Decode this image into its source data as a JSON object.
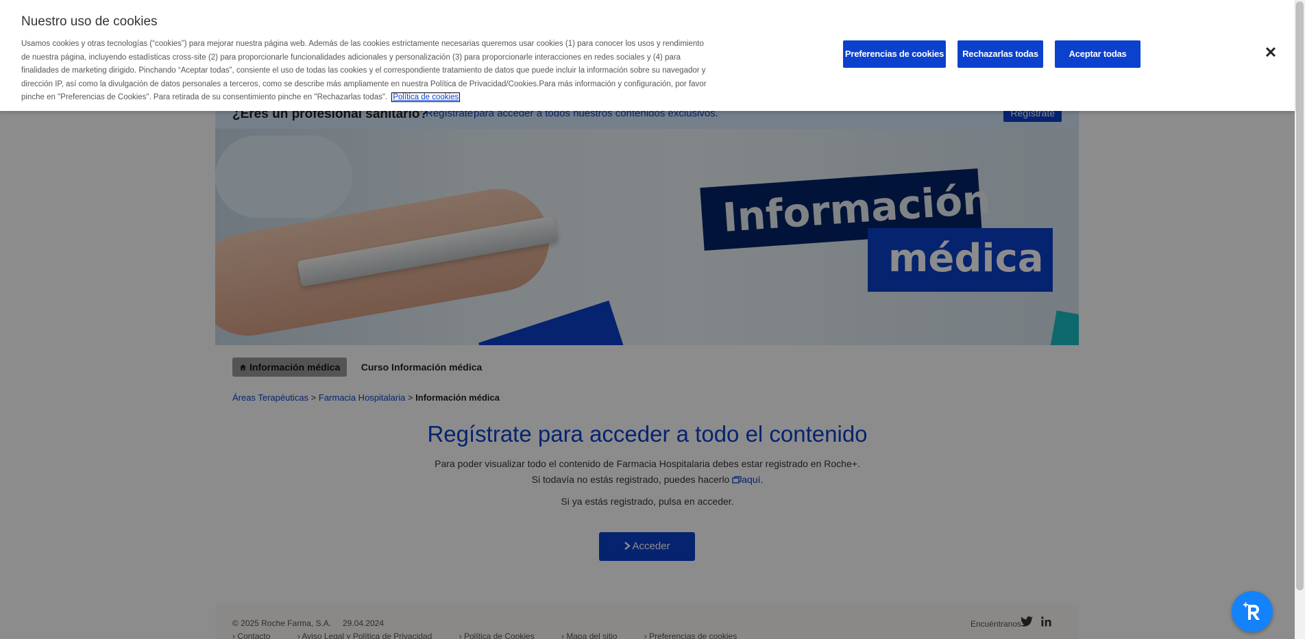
{
  "cookie_banner": {
    "title": "Nuestro uso de cookies",
    "body": "Usamos cookies y otras tecnologías (“cookies”) para mejorar nuestra página web. Además de las cookies estrictamente necesarias queremos usar cookies (1) para conocer los usos y rendimiento de nuestra página, incluyendo estadísticas cross-site (2) para proporcionarle funcionalidades adicionales y personalización (3) para proporcionarle interacciones en redes sociales y (4) para finalidades de marketing dirigido. Pinchando “Aceptar todas”, consiente el uso de todas las cookies y el correspondiente tratamiento de datos que puede incluir la información sobre su navegador y dirección IP, así como la divulgación de datos personales a terceros, como se describe más ampliamente en nuestra Política de Privacidad/Cookies.Para más información y configuración, por favor pinche en \"Preferencias de Cookies\". Para retirada de su consentimiento pinche en \"Rechazarlas todas\".",
    "policy_link": "Política de cookies",
    "preferences_button": "Preferencias de cookies",
    "reject_button": "Rechazarlas todas",
    "accept_button": "Aceptar todas",
    "close_icon": "close-icon"
  },
  "hcp_bar": {
    "question": "¿Eres un profesional sanitario?",
    "link": "Regístrate",
    "rest": "para acceder a todos nuestros contenidos exclusivos.",
    "button": "Regístrate"
  },
  "hero": {
    "line1": "Información",
    "line2": "médica"
  },
  "tabs": [
    {
      "label": "Información médica",
      "active": true,
      "icon": "home-icon"
    },
    {
      "label": "Curso Información médica",
      "active": false
    }
  ],
  "breadcrumb": {
    "item1": "Áreas Terapéuticas",
    "item2": "Farmacia Hospitalaria",
    "current": "Información médica",
    "separator": ">"
  },
  "main": {
    "title": "Regístrate para acceder a todo el contenido",
    "line1": "Para poder visualizar todo el contenido de Farmacia Hospitalaria debes estar registrado en Roche+.",
    "line2_prefix": "Si todavía no estás registrado, puedes hacerlo",
    "line2_link": "aquí",
    "line2_suffix": ".",
    "line3": "Si ya estás registrado, pulsa en acceder.",
    "acceder_button": "Acceder"
  },
  "footer": {
    "copyright": "© 2025 Roche Farma, S.A.",
    "date": "29.04.2024",
    "links": [
      "Contacto",
      "Aviso Legal y Política de Privacidad",
      "Política de Cookies",
      "Mapa del sitio",
      "Preferencias de cookies"
    ],
    "find_us": "Encuéntranos",
    "social": [
      "twitter-icon",
      "linkedin-icon"
    ]
  },
  "colors": {
    "accent": "#0b41cd",
    "navy": "#022366",
    "fab": "#1482fa"
  }
}
